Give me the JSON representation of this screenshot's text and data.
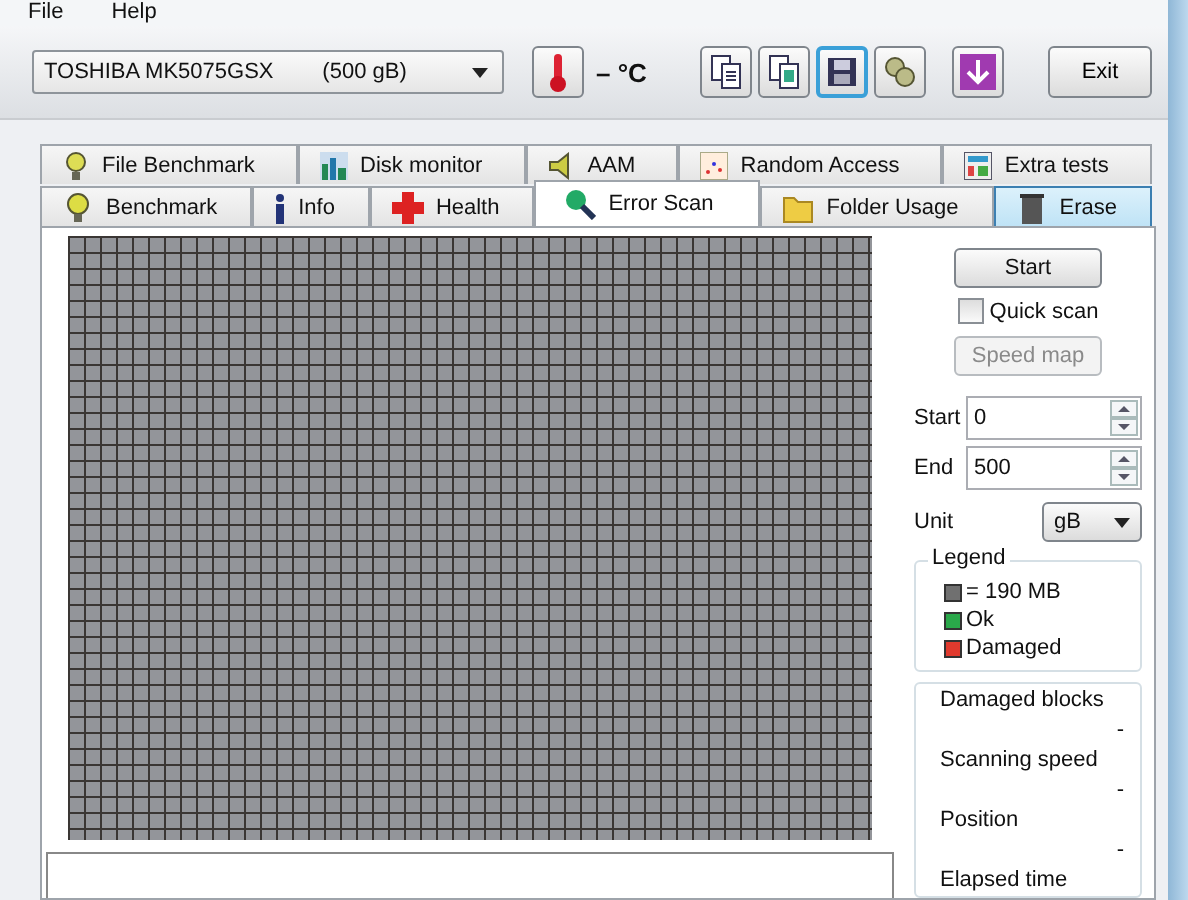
{
  "menu": [
    "File",
    "Help"
  ],
  "drive": {
    "value": "TOSHIBA MK5075GSX        (500 gB)"
  },
  "temperature": "– °C",
  "toolbar": [
    {
      "kind": "copy",
      "focused": false
    },
    {
      "kind": "copy-image",
      "focused": false
    },
    {
      "kind": "save",
      "focused": true
    },
    {
      "kind": "options",
      "focused": false
    },
    {
      "kind": "download",
      "focused": false
    }
  ],
  "exit": "Exit",
  "tabs_top": [
    {
      "label": "File Benchmark"
    },
    {
      "label": "Disk monitor"
    },
    {
      "label": "AAM"
    },
    {
      "label": "Random Access"
    },
    {
      "label": "Extra tests"
    }
  ],
  "tabs": [
    {
      "label": "Benchmark",
      "selected": false,
      "hot": false
    },
    {
      "label": "Info",
      "selected": false,
      "hot": false
    },
    {
      "label": "Health",
      "selected": false,
      "hot": false
    },
    {
      "label": "Error Scan",
      "selected": true,
      "hot": false
    },
    {
      "label": "Folder Usage",
      "selected": false,
      "hot": false
    },
    {
      "label": "Erase",
      "selected": false,
      "hot": true
    }
  ],
  "start_button": "Start",
  "quick_scan": {
    "label": "Quick scan",
    "checked": false
  },
  "speed_map": {
    "label": "Speed map",
    "disabled": true
  },
  "start": {
    "label": "Start",
    "value": "0"
  },
  "end": {
    "label": "End",
    "value": "500"
  },
  "unit": {
    "label": "Unit",
    "value": "gB"
  },
  "legend": {
    "title": "Legend",
    "items": [
      {
        "label": "= 190 MB",
        "color": "#707070"
      },
      {
        "label": "Ok",
        "color": "#2aa84a"
      },
      {
        "label": "Damaged",
        "color": "#e03a2e"
      }
    ]
  },
  "stats": [
    {
      "label": "Damaged blocks",
      "value": "-"
    },
    {
      "label": "Scanning speed",
      "value": "-"
    },
    {
      "label": "Position",
      "value": "-"
    },
    {
      "label": "Elapsed time"
    }
  ]
}
